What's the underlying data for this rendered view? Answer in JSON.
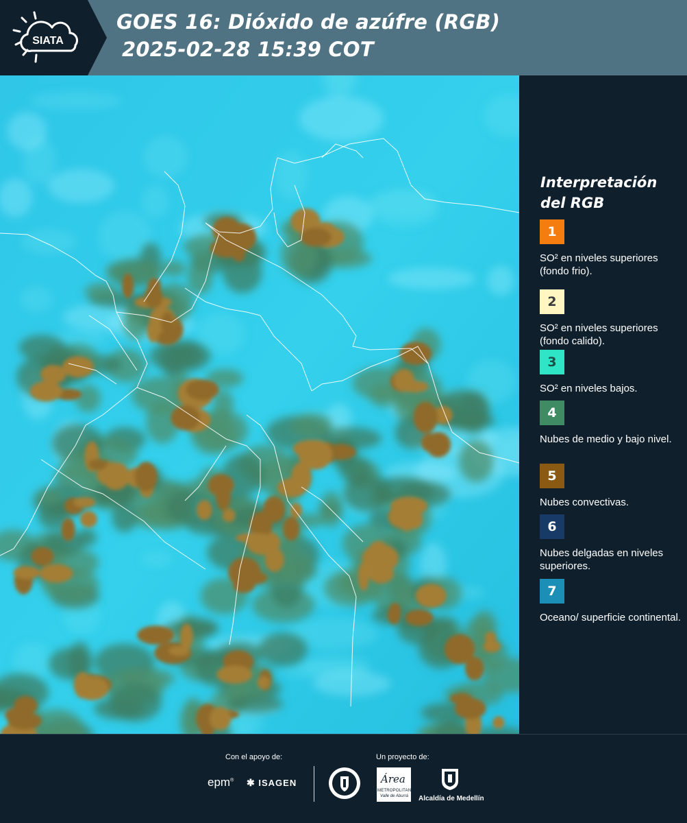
{
  "header": {
    "logo_text": "SIATA",
    "title_line1": "GOES 16: Dióxido de azúfre (RGB)",
    "title_line2": "2025-02-28 15:39 COT"
  },
  "legend": {
    "title_line1": "Interpretación",
    "title_line2": "del RGB",
    "items": [
      {
        "number": "1",
        "label": "SO² en niveles superiores (fondo frio).",
        "color": "#f57c0e",
        "text_color": "#ffffff"
      },
      {
        "number": "2",
        "label": "SO² en niveles superiores (fondo calido).",
        "color": "#fff6c2",
        "text_color": "#3a3a3a"
      },
      {
        "number": "3",
        "label": "SO² en niveles bajos.",
        "color": "#2ee6c6",
        "text_color": "#1d4e48"
      },
      {
        "number": "4",
        "label": "Nubes de medio y bajo nivel.",
        "color": "#3f8c64",
        "text_color": "#ffffff"
      },
      {
        "number": "5",
        "label": "Nubes convectivas.",
        "color": "#8a5a12",
        "text_color": "#ffffff"
      },
      {
        "number": "6",
        "label": "Nubes delgadas en niveles superiores.",
        "color": "#173a66",
        "text_color": "#ffffff"
      },
      {
        "number": "7",
        "label": "Oceano/ superficie continental.",
        "color": "#1b8fb6",
        "text_color": "#ffffff"
      }
    ]
  },
  "footer": {
    "support_caption": "Con el apoyo de:",
    "project_caption": "Un proyecto de:",
    "logo_epm": "epm",
    "logo_isagen": "ISAGEN",
    "logo_area": "Área",
    "logo_area_sub1": "METROPOLITANA",
    "logo_area_sub2": "Valle de Aburrá",
    "logo_alcaldia": "Alcaldía de Medellín"
  },
  "colors": {
    "background": "#0f1f2c",
    "header_band": "#4f7382",
    "map_cyan": "#27c4e6",
    "cloud_brown": "#9e7a35",
    "cloud_green": "#4a8a6a"
  }
}
